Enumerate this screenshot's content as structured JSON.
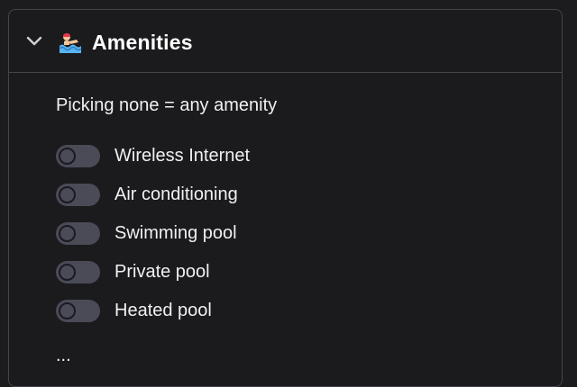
{
  "section": {
    "title": "Amenities",
    "emoji_icon": "swimmer-emoji-icon",
    "collapse_icon": "chevron-down-icon",
    "hint": "Picking none = any amenity",
    "more_indicator": "..."
  },
  "amenities": [
    {
      "label": "Wireless Internet",
      "enabled": false
    },
    {
      "label": "Air conditioning",
      "enabled": false
    },
    {
      "label": "Swimming pool",
      "enabled": false
    },
    {
      "label": "Private pool",
      "enabled": false
    },
    {
      "label": "Heated pool",
      "enabled": false
    }
  ],
  "colors": {
    "background": "#1b1b1e",
    "border": "#44444a",
    "toggle_off": "#4a4b57",
    "text": "#f0f0f0"
  }
}
